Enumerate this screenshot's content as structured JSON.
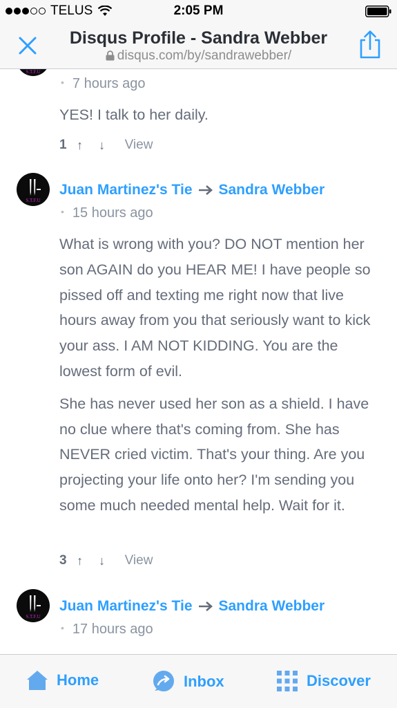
{
  "status_bar": {
    "carrier": "TELUS",
    "time": "2:05 PM"
  },
  "header": {
    "title": "Disqus Profile - Sandra Webber",
    "url": "disqus.com/by/sandrawebber/",
    "close_icon": "close-x-icon",
    "share_icon": "share-icon"
  },
  "comments": [
    {
      "avatar_text": "S.T.F.U",
      "time": "7 hours ago",
      "body": [
        "YES! I talk to her daily."
      ],
      "votes": "1",
      "view_label": "View"
    },
    {
      "author": "Juan Martinez's Tie",
      "reply_to": "Sandra Webber",
      "avatar_text": "S.T.F.U",
      "time": "15 hours ago",
      "body": [
        "What is wrong with you? DO NOT mention her son AGAIN do you HEAR ME! I have people so pissed off and texting me right now that live hours away from you that seriously want to kick your ass. I AM NOT KIDDING. You are the lowest form of evil.",
        "She has never used her son as a shield. I have no clue where that's coming from. She has NEVER cried victim. That's your thing. Are you projecting your life onto her? I'm sending you some much needed mental help. Wait for it."
      ],
      "votes": "3",
      "view_label": "View"
    },
    {
      "author": "Juan Martinez's Tie",
      "reply_to": "Sandra Webber",
      "avatar_text": "S.T.F.U",
      "time": "17 hours ago"
    }
  ],
  "tabbar": {
    "home_label": "Home",
    "inbox_label": "Inbox",
    "discover_label": "Discover"
  },
  "colors": {
    "accent": "#2e9fff",
    "text": "#656c7a",
    "meta": "#8a93a0"
  }
}
